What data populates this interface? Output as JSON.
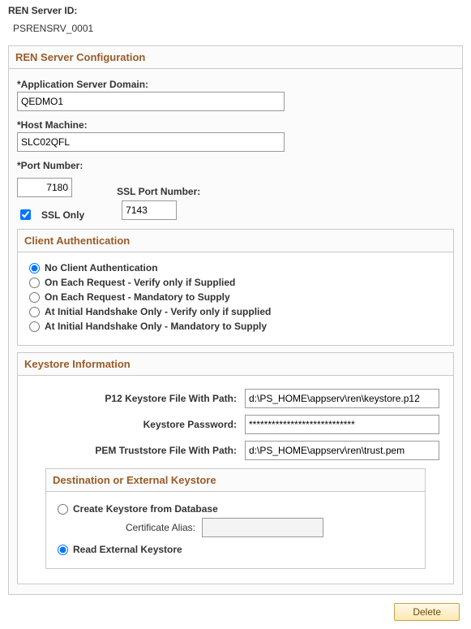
{
  "header": {
    "ren_server_id_label": "REN Server ID:",
    "ren_server_id_value": "PSRENSRV_0001"
  },
  "config": {
    "title": "REN Server Configuration",
    "app_server_domain_label": "Application Server Domain:",
    "app_server_domain_value": "QEDMO1",
    "host_machine_label": "Host Machine:",
    "host_machine_value": "SLC02QFL",
    "port_number_label": "Port Number:",
    "port_number_value": "7180",
    "ssl_only_label": "SSL Only",
    "ssl_only_checked": true,
    "ssl_port_label": "SSL Port Number:",
    "ssl_port_value": "7143"
  },
  "client_auth": {
    "title": "Client Authentication",
    "options": [
      "No Client Authentication",
      "On Each Request - Verify only if Supplied",
      "On Each Request - Mandatory to Supply",
      "At Initial Handshake Only - Verify only if supplied",
      "At Initial Handshake Only - Mandatory to Supply"
    ],
    "selected_index": 0
  },
  "keystore": {
    "title": "Keystore Information",
    "p12_label": "P12 Keystore File With Path:",
    "p12_value": "d:\\PS_HOME\\appserv\\ren\\keystore.p12",
    "pwd_label": "Keystore Password:",
    "pwd_value": "****************************",
    "pem_label": "PEM Truststore File With Path:",
    "pem_value": "d:\\PS_HOME\\appserv\\ren\\trust.pem",
    "dest": {
      "title": "Destination or External Keystore",
      "create_label": "Create Keystore from Database",
      "cert_alias_label": "Certificate Alias:",
      "cert_alias_value": "",
      "read_label": "Read External Keystore",
      "selected": "read"
    }
  },
  "buttons": {
    "delete": "Delete"
  }
}
